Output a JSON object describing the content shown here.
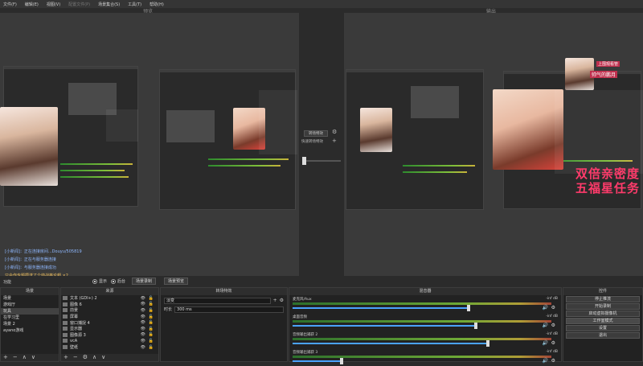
{
  "menu": [
    {
      "label": "文件(F)",
      "disabled": false
    },
    {
      "label": "编辑(E)",
      "disabled": false
    },
    {
      "label": "视图(V)",
      "disabled": false
    },
    {
      "label": "配置文件(P)",
      "disabled": true
    },
    {
      "label": "场景集合(S)",
      "disabled": false
    },
    {
      "label": "工具(T)",
      "disabled": false
    },
    {
      "label": "帮助(H)",
      "disabled": false
    }
  ],
  "preview": {
    "left_label": "预览",
    "right_label": "输出",
    "sticker_title_1": "上围观看管",
    "sticker_title_2": "帅气的鹏月",
    "overlay_line_1": "双倍亲密度",
    "overlay_line_2": "五福星任务",
    "log_lines": [
      "[小新闻]：正在连接房间...Douyu/505819",
      "[小新闻]：正在与服务器连接",
      "[小新闻]：与服务器连接成功",
      "只会作专题攒送了个帅战英论帽 ×2"
    ]
  },
  "transition_center": {
    "button_1": "转场特效",
    "quick_label": "快速转场特效",
    "plus": "+",
    "gear": "⚙"
  },
  "modebar": {
    "left_text": "功能",
    "radio_1": "显示",
    "radio_2": "后台",
    "btn_1": "场景录制",
    "btn_2": "场景预览"
  },
  "scenes": {
    "title": "场景",
    "items": [
      "场景",
      "游戏厅",
      "玩具",
      "在学习里",
      "场景 2",
      "ayano游戏"
    ],
    "selected": 2,
    "footer": [
      "+",
      "−",
      "∧",
      "∨"
    ]
  },
  "sources": {
    "title": "来源",
    "items": [
      "文本 (GDI+) 2",
      "图像 6",
      "前景",
      "屏幕",
      "窗口捕捉 4",
      "显示器",
      "图像源 3",
      "vcA",
      "壁纸"
    ],
    "footer": [
      "+",
      "−",
      "⚙",
      "∧",
      "∨"
    ]
  },
  "transitions": {
    "title": "转场特效",
    "selected": "淡变",
    "duration_label": "时长",
    "duration_value": "300 ms"
  },
  "mixer": {
    "title": "混音器",
    "channels": [
      {
        "name": "麦克风/Aux",
        "db": "-inf dB",
        "level": 0.72
      },
      {
        "name": "桌面音频",
        "db": "-inf dB",
        "level": 0.75
      },
      {
        "name": "音频输出捕获 2",
        "db": "-inf dB",
        "level": 0.8
      },
      {
        "name": "音频输出捕获 3",
        "db": "-inf dB",
        "level": 0.2
      }
    ]
  },
  "controls": {
    "title": "控件",
    "buttons": [
      "停止推流",
      "开始录制",
      "启动虚拟摄像机",
      "工作室模式",
      "设置",
      "退出"
    ],
    "active": 3
  },
  "colors": {
    "accent": "#4aa3ff",
    "overlay_pink": "#ff3b6b",
    "log_blue": "#8fb8ff"
  }
}
